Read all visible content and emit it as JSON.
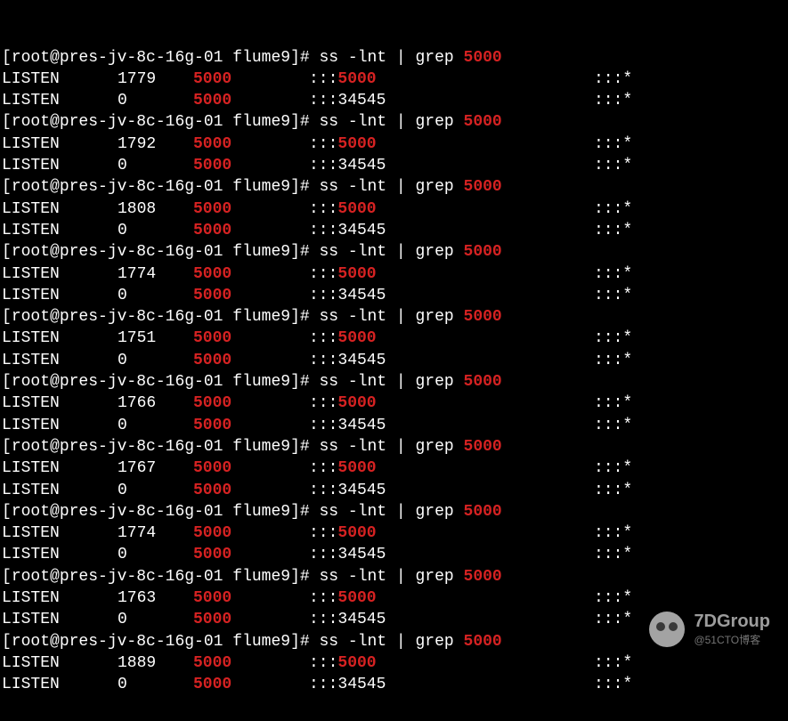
{
  "prompt": {
    "open": "[",
    "user_host": "root@pres-jv-8c-16g-01",
    "space": " ",
    "dir": "flume9",
    "close": "]# ",
    "cmd_pre": "ss -lnt | grep ",
    "cmd_hl": "5000"
  },
  "row_template": {
    "state": "LISTEN",
    "colon_prefix": ":::",
    "port_hl": "5000",
    "port_plain": "34545",
    "peer": ":::*"
  },
  "blocks": [
    {
      "recvq1": "1779",
      "sendq": "5000",
      "recvq2": "0"
    },
    {
      "recvq1": "1792",
      "sendq": "5000",
      "recvq2": "0"
    },
    {
      "recvq1": "1808",
      "sendq": "5000",
      "recvq2": "0"
    },
    {
      "recvq1": "1774",
      "sendq": "5000",
      "recvq2": "0"
    },
    {
      "recvq1": "1751",
      "sendq": "5000",
      "recvq2": "0"
    },
    {
      "recvq1": "1766",
      "sendq": "5000",
      "recvq2": "0"
    },
    {
      "recvq1": "1767",
      "sendq": "5000",
      "recvq2": "0"
    },
    {
      "recvq1": "1774",
      "sendq": "5000",
      "recvq2": "0"
    },
    {
      "recvq1": "1763",
      "sendq": "5000",
      "recvq2": "0"
    },
    {
      "recvq1": "1889",
      "sendq": "5000",
      "recvq2": "0"
    }
  ],
  "watermark": {
    "main": "7DGroup",
    "sub": "@51CTO博客"
  }
}
